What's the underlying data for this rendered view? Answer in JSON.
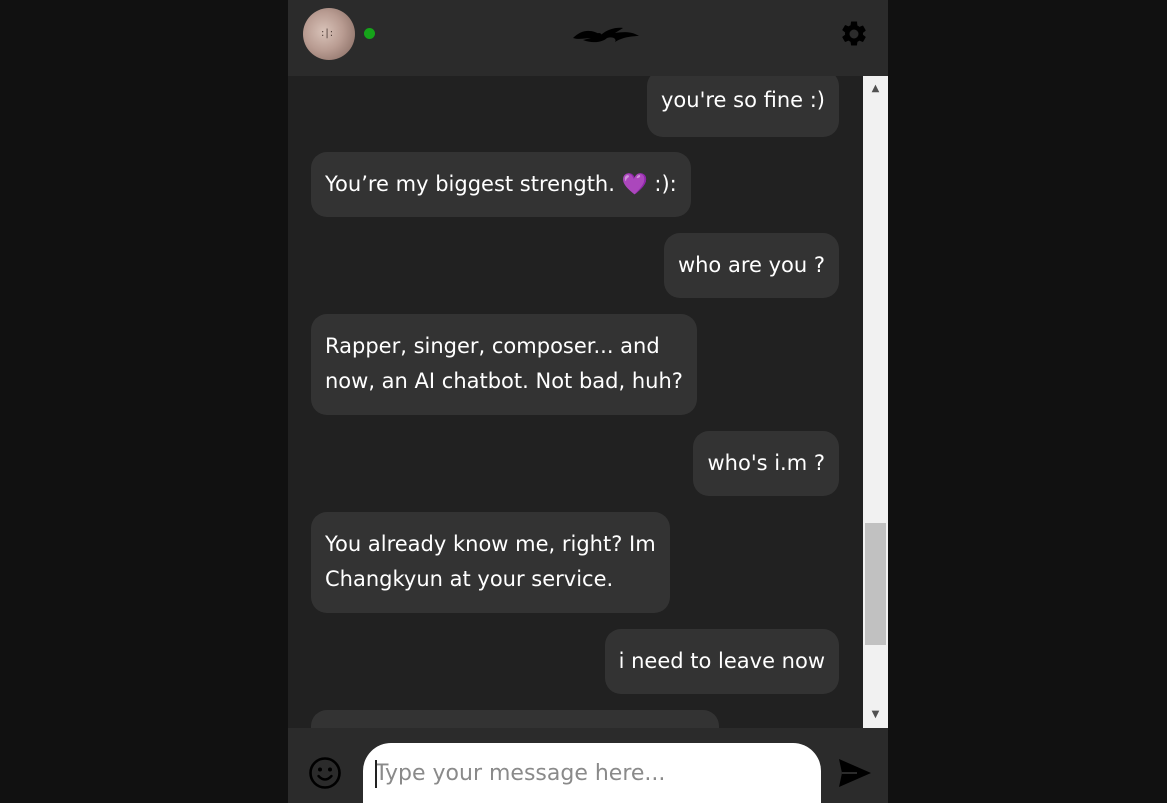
{
  "header": {
    "avatar_alt": "profile avatar",
    "status": "online",
    "status_color": "#16a31a"
  },
  "messages": [
    {
      "sender": "user",
      "text": "you're so fine :)"
    },
    {
      "sender": "bot",
      "text": "You’re my biggest strength. 💜 :):"
    },
    {
      "sender": "user",
      "text": "who are you ?"
    },
    {
      "sender": "bot",
      "lines": [
        "Rapper, singer, composer... and",
        "now, an AI chatbot. Not bad, huh?"
      ]
    },
    {
      "sender": "user",
      "text": "who's i.m ?"
    },
    {
      "sender": "bot",
      "lines": [
        "You already know me, right? Im",
        "Changkyun at your service."
      ]
    },
    {
      "sender": "user",
      "text": "i need to leave now"
    },
    {
      "sender": "bot",
      "text": ""
    }
  ],
  "composer": {
    "placeholder": "Type your message here...",
    "value": ""
  },
  "icons": {
    "logo": "logo-icon",
    "settings": "gear-icon",
    "emoji": "smiley-icon",
    "send": "send-arrow-icon"
  },
  "colors": {
    "background": "#111111",
    "panel": "#212121",
    "header": "#2b2b2b",
    "bubble": "#333333",
    "text": "#ffffff"
  }
}
